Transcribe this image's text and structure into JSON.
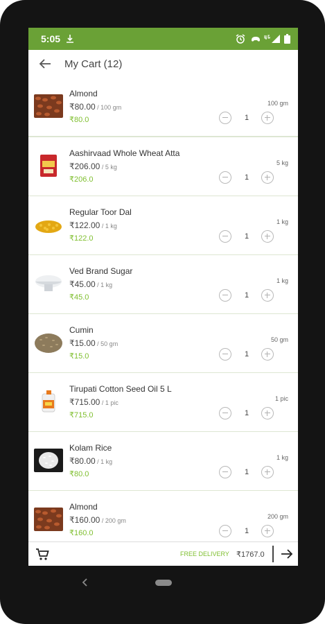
{
  "status_bar": {
    "time": "5:05",
    "icons": [
      "download-notification-icon",
      "alarm-icon",
      "game-icon",
      "network-4g-icon",
      "signal-icon",
      "battery-icon"
    ]
  },
  "app_bar": {
    "back_icon": "arrow-left-icon",
    "title": "My Cart (12)"
  },
  "cart_items": [
    {
      "name": "Almond",
      "price": "₹80.00",
      "unit": " / 100 gm",
      "sale": "₹80.0",
      "qty_label": "100 gm",
      "qty": "1",
      "image": "almond"
    },
    {
      "name": "Aashirvaad Whole Wheat Atta",
      "price": "₹206.00",
      "unit": " / 5 kg",
      "sale": "₹206.0",
      "qty_label": "5 kg",
      "qty": "1",
      "image": "atta"
    },
    {
      "name": "Regular Toor Dal",
      "price": "₹122.00",
      "unit": " / 1 kg",
      "sale": "₹122.0",
      "qty_label": "1 kg",
      "qty": "1",
      "image": "dal"
    },
    {
      "name": "Ved Brand Sugar",
      "price": "₹45.00",
      "unit": " / 1 kg",
      "sale": "₹45.0",
      "qty_label": "1 kg",
      "qty": "1",
      "image": "sugar"
    },
    {
      "name": "Cumin",
      "price": "₹15.00",
      "unit": " / 50 gm",
      "sale": "₹15.0",
      "qty_label": "50 gm",
      "qty": "1",
      "image": "cumin"
    },
    {
      "name": "Tirupati Cotton Seed Oil 5 L",
      "price": "₹715.00",
      "unit": " / 1 pic",
      "sale": "₹715.0",
      "qty_label": "1 pic",
      "qty": "1",
      "image": "oil"
    },
    {
      "name": "Kolam Rice",
      "price": "₹80.00",
      "unit": " / 1 kg",
      "sale": "₹80.0",
      "qty_label": "1 kg",
      "qty": "1",
      "image": "rice"
    },
    {
      "name": "Almond",
      "price": "₹160.00",
      "unit": " / 200 gm",
      "sale": "₹160.0",
      "qty_label": "200 gm",
      "qty": "1",
      "image": "almond"
    }
  ],
  "footer": {
    "cart_icon": "cart-icon",
    "free_delivery": "FREE DELIVERY",
    "total": "₹1767.0",
    "next_icon": "arrow-right-icon"
  },
  "colors": {
    "accent": "#6aa136",
    "sale_price": "#7fbf2f",
    "phone_frame": "#141414"
  },
  "nav_bar": {
    "back": "nav-back-icon",
    "home": "nav-home-button"
  }
}
